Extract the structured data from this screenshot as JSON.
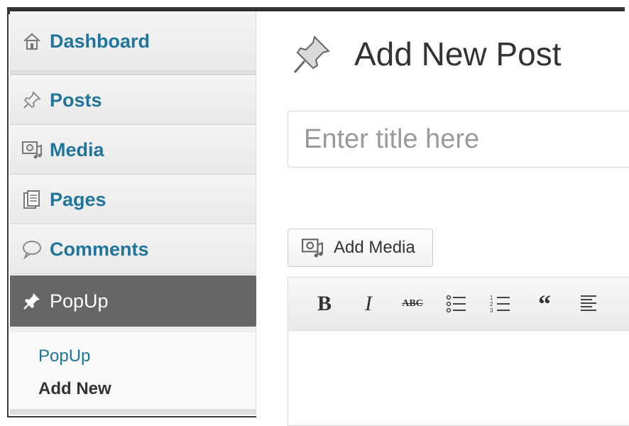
{
  "sidebar": {
    "items": [
      {
        "label": "Dashboard",
        "icon": "home-icon"
      },
      {
        "label": "Posts",
        "icon": "pushpin-icon"
      },
      {
        "label": "Media",
        "icon": "media-icon"
      },
      {
        "label": "Pages",
        "icon": "pages-icon"
      },
      {
        "label": "Comments",
        "icon": "comment-bubble-icon"
      },
      {
        "label": "PopUp",
        "icon": "pushpin-icon",
        "active": true
      }
    ],
    "submenu": [
      "PopUp",
      "Add New"
    ]
  },
  "main": {
    "title": "Add New Post",
    "title_placeholder": "Enter title here",
    "add_media_label": "Add Media",
    "toolbar": {
      "bold": "B",
      "italic": "I",
      "strikethrough": "ABC",
      "quote": "“"
    }
  },
  "colors": {
    "link": "#21759b",
    "active_bg": "#666666",
    "sidebar_bg": "#eeeeee"
  }
}
